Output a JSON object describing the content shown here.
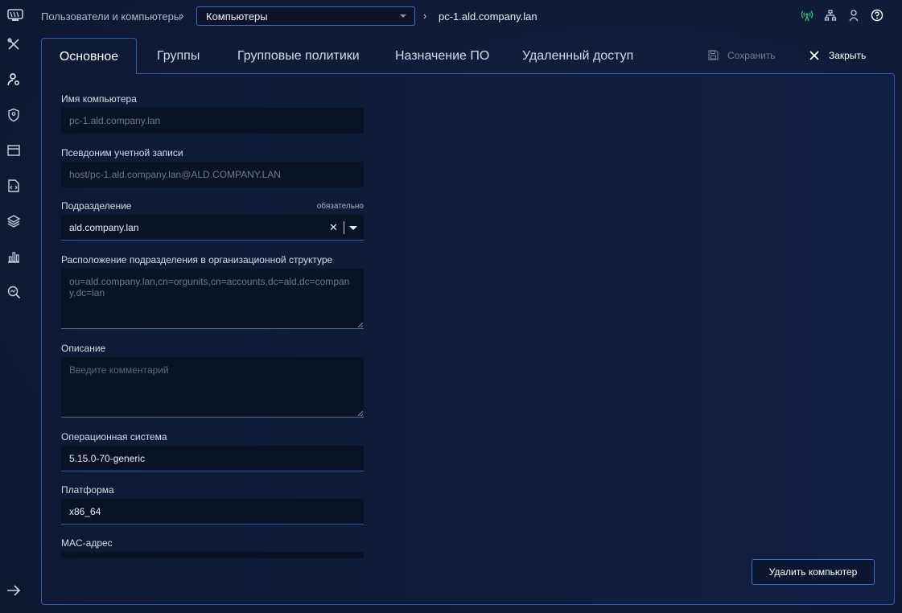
{
  "breadcrumb": {
    "root": "Пользователи и компьютеры",
    "section": "Компьютеры",
    "current": "pc-1.ald.company.lan"
  },
  "tabs": [
    {
      "label": "Основное",
      "active": true
    },
    {
      "label": "Группы"
    },
    {
      "label": "Групповые политики"
    },
    {
      "label": "Назначение ПО"
    },
    {
      "label": "Удаленный доступ"
    }
  ],
  "toolbar": {
    "save_label": "Сохранить",
    "close_label": "Закрыть"
  },
  "form": {
    "computer_name": {
      "label": "Имя компьютера",
      "value": "pc-1.ald.company.lan"
    },
    "principal": {
      "label": "Псевдоним учетной записи",
      "value": "host/pc-1.ald.company.lan@ALD.COMPANY.LAN"
    },
    "unit": {
      "label": "Подразделение",
      "required": "обязательно",
      "value": "ald.company.lan"
    },
    "unit_dn": {
      "label": "Расположение подразделения в организационной структуре",
      "value": "ou=ald.company.lan,cn=orgunits,cn=accounts,dc=ald,dc=company,dc=lan"
    },
    "description": {
      "label": "Описание",
      "placeholder": "Введите комментарий"
    },
    "os": {
      "label": "Операционная система",
      "value": "5.15.0-70-generic"
    },
    "platform": {
      "label": "Платформа",
      "value": "x86_64"
    },
    "mac": {
      "label": "MAC-адрес"
    }
  },
  "actions": {
    "delete_label": "Удалить компьютер"
  },
  "colors": {
    "accent": "#2f5aa8",
    "status_green": "#2fbf71",
    "background": "#0f1b33"
  }
}
